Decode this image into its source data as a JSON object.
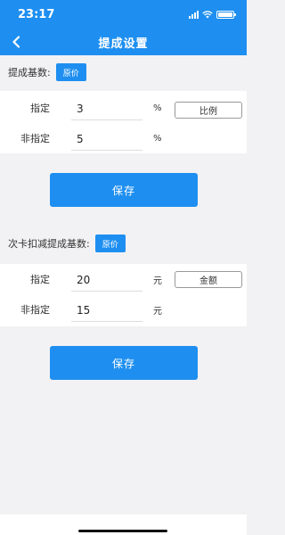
{
  "status_bar": {
    "time": "23:17"
  },
  "nav": {
    "title": "提成设置",
    "back_icon": "chevron-left-icon"
  },
  "section1": {
    "label": "提成基数:",
    "base_button": "原价",
    "rows": [
      {
        "label": "指定",
        "value": "3",
        "unit": "%",
        "button": "比例"
      },
      {
        "label": "非指定",
        "value": "5",
        "unit": "%"
      }
    ],
    "save_label": "保存"
  },
  "section2": {
    "label": "次卡扣减提成基数:",
    "base_button": "原价",
    "rows": [
      {
        "label": "指定",
        "value": "20",
        "unit": "元",
        "button": "金额"
      },
      {
        "label": "非指定",
        "value": "15",
        "unit": "元"
      }
    ],
    "save_label": "保存"
  },
  "colors": {
    "primary": "#1e8ff0",
    "background": "#f2f2f4"
  }
}
